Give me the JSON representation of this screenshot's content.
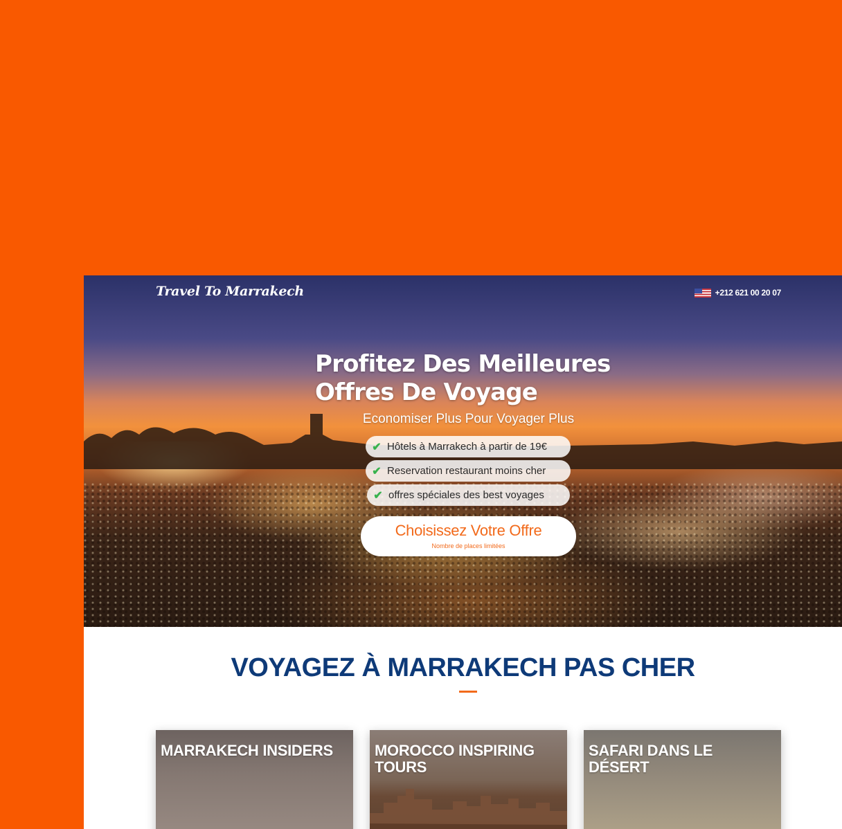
{
  "header": {
    "logo": "Travel To Marrakech",
    "phone": "+212 621 00 20 07",
    "flag_icon": "us-flag-icon"
  },
  "hero": {
    "headline_line1": "Profitez Des Meilleures",
    "headline_line2": "Offres De Voyage",
    "subline": "Economiser Plus Pour Voyager Plus",
    "features": [
      "Hôtels à Marrakech à partir de 19€",
      "Reservation restaurant moins cher",
      "offres spéciales des best voyages"
    ],
    "cta_label": "Choisissez Votre Offre",
    "cta_sub": "Nombre de places limitées"
  },
  "section": {
    "title": "VOYAGEZ À MARRAKECH PAS CHER"
  },
  "cards": [
    {
      "title": "MARRAKECH INSIDERS"
    },
    {
      "title": "MOROCCO INSPIRING TOURS"
    },
    {
      "title": "SAFARI DANS LE DÉSERT"
    }
  ],
  "colors": {
    "background": "#f95900",
    "accent": "#f26a1b",
    "title": "#0e3a78",
    "check": "#37b24d"
  }
}
